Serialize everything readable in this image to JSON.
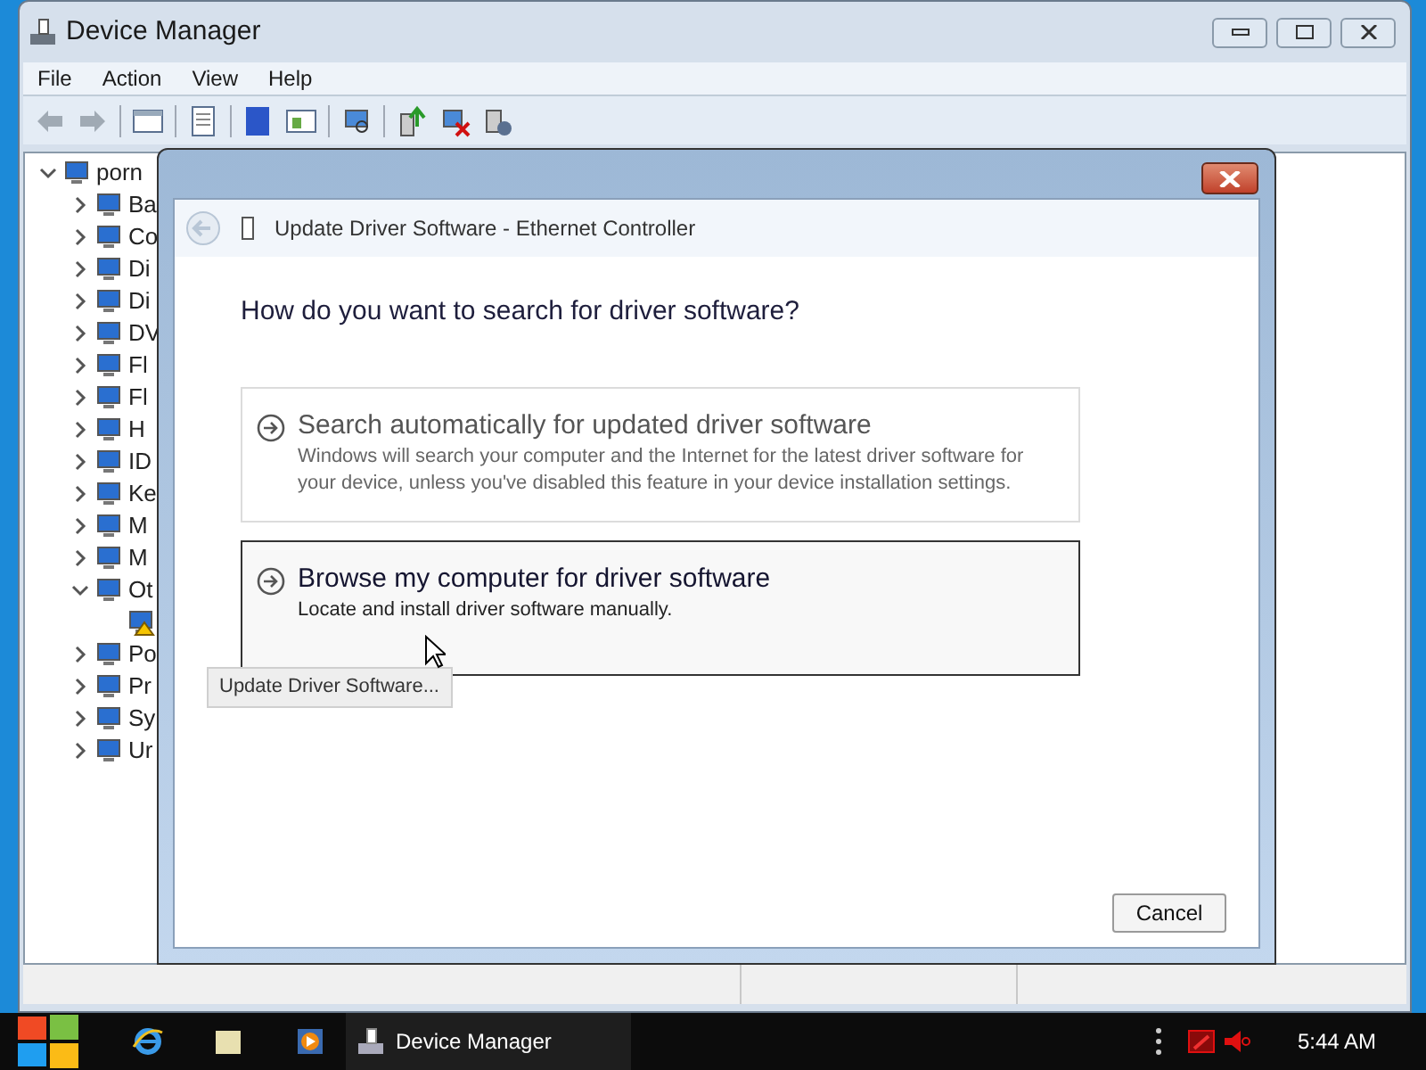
{
  "window": {
    "title": "Device Manager"
  },
  "menu": [
    "File",
    "Action",
    "View",
    "Help"
  ],
  "tree": {
    "label": "porn",
    "expanded": true,
    "children": [
      {
        "label": "Ba",
        "expanded": false
      },
      {
        "label": "Co",
        "expanded": false
      },
      {
        "label": "Di",
        "expanded": false
      },
      {
        "label": "Di",
        "expanded": false
      },
      {
        "label": "DV",
        "expanded": false
      },
      {
        "label": "Fl",
        "expanded": false
      },
      {
        "label": "Fl",
        "expanded": false
      },
      {
        "label": "H",
        "expanded": false
      },
      {
        "label": "ID",
        "expanded": false
      },
      {
        "label": "Ke",
        "expanded": false
      },
      {
        "label": "M",
        "expanded": false
      },
      {
        "label": "M",
        "expanded": false
      },
      {
        "label": "Ot",
        "expanded": true,
        "children": [
          {
            "kind": "warning"
          }
        ]
      },
      {
        "label": "Po",
        "expanded": false
      },
      {
        "label": "Pr",
        "expanded": false
      },
      {
        "label": "Sy",
        "expanded": false
      },
      {
        "label": "Ur",
        "expanded": false
      }
    ]
  },
  "dialog": {
    "title": "Update Driver Software - Ethernet Controller",
    "heading": "How do you want to search for driver software?",
    "options": [
      {
        "title": "Search automatically for updated driver software",
        "description": "Windows will search your computer and the Internet for the latest driver software for your device, unless you've disabled this feature in your device installation settings.",
        "hovered": false
      },
      {
        "title": "Browse my computer for driver software",
        "description": "Locate and install driver software manually.",
        "hovered": true
      }
    ],
    "cancel": "Cancel"
  },
  "tooltip": "Update Driver Software...",
  "taskbar": {
    "task": "Device Manager",
    "time": "5:44 AM"
  }
}
